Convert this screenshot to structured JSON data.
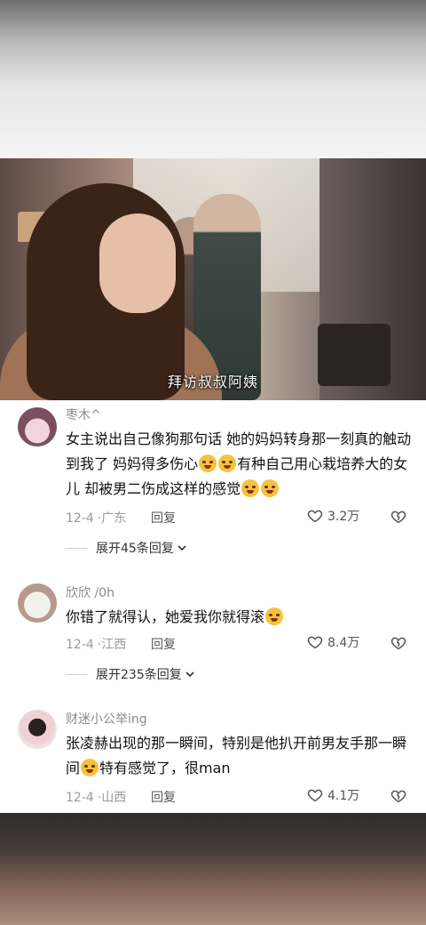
{
  "video": {
    "subtitle": "拜访叔叔阿姨"
  },
  "comments": [
    {
      "username": "枣木^",
      "text_parts": [
        "女主说出自己像狗那句话 她的妈妈转身那一刻真的触动到我了 妈妈得多伤心",
        "有种自己用心栽培养大的女儿 却被男二伤成这样的感觉"
      ],
      "date": "12-4",
      "location": "广东",
      "reply_label": "回复",
      "likes": "3.2万",
      "expand_label": "展开45条回复"
    },
    {
      "username": "欣欣 /0h",
      "text_parts": [
        "你错了就得认，她爱我你就得滚"
      ],
      "date": "12-4",
      "location": "江西",
      "reply_label": "回复",
      "likes": "8.4万",
      "expand_label": "展开235条回复"
    },
    {
      "username": "财迷小公举ing",
      "text_parts": [
        "张凌赫出现的那一瞬间，特别是他扒开前男友手那一瞬间",
        "特有感觉了，很man"
      ],
      "date": "12-4",
      "location": "山西",
      "reply_label": "回复",
      "likes": "4.1万"
    }
  ],
  "icons": {
    "like": "heart-outline-icon",
    "dislike": "broken-heart-icon",
    "expand": "chevron-down-icon",
    "emoji_cry": "crying-emoji-icon",
    "emoji_laugh": "laughing-emoji-icon",
    "emoji_shy": "flushed-emoji-icon"
  }
}
